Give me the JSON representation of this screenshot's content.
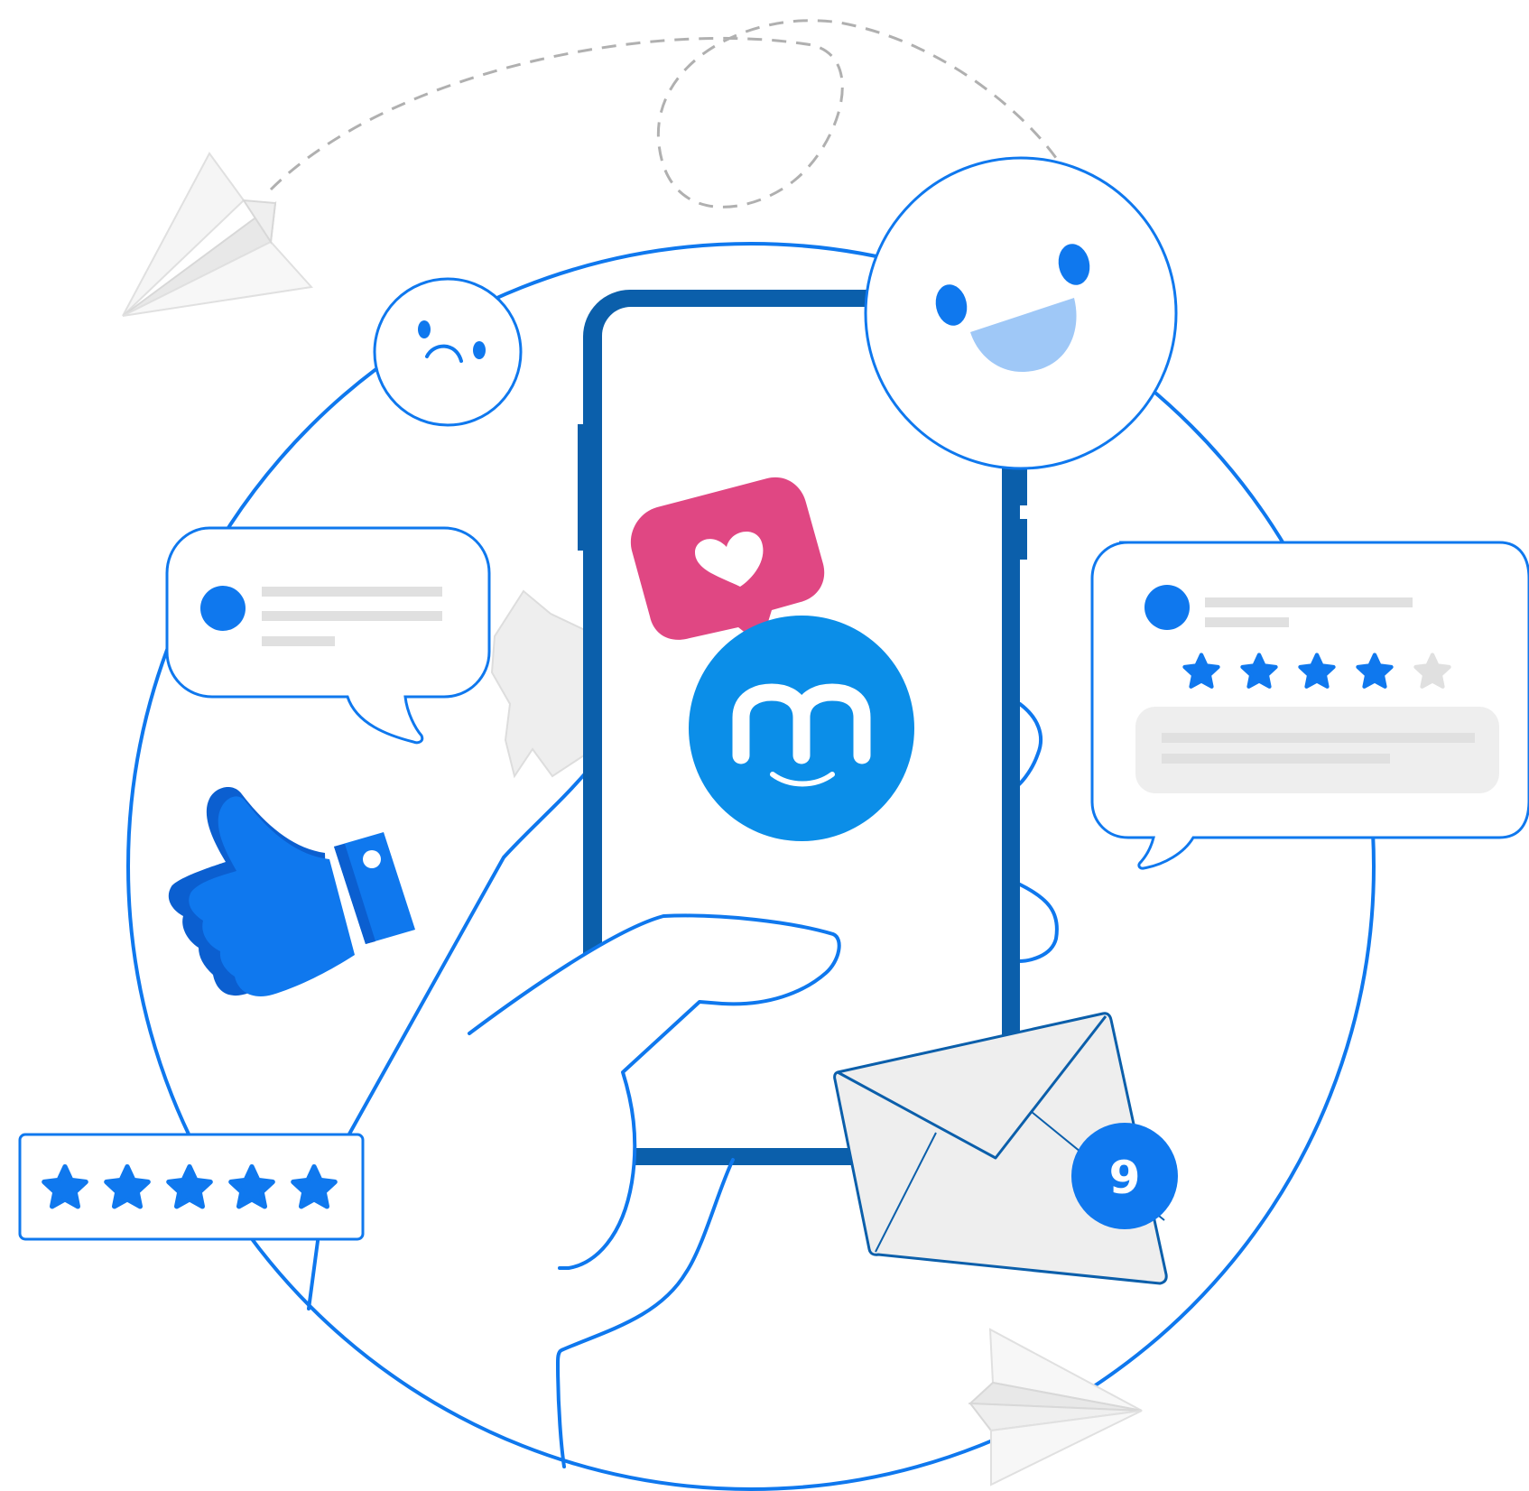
{
  "colors": {
    "primary_blue": "#0f78ee",
    "dark_blue": "#0b5fab",
    "app_blue": "#0b8ee8",
    "pink": "#e04783",
    "light_blue": "#9fc8f7",
    "gray_fill": "#eeeeee",
    "gray_line": "#e0e0e0",
    "dashed": "#b0b0b0"
  },
  "icons": {
    "app_logo": "myjobmatcher-m-smile-logo",
    "sad_face": "sad-face-icon",
    "happy_face": "happy-face-icon",
    "heart_notification": "heart-notification-icon",
    "thumbs_up": "thumbs-up-icon",
    "envelope": "envelope-icon",
    "paper_plane": "paper-plane-icon",
    "star": "star-icon"
  },
  "review_card": {
    "rating": 4,
    "max_rating": 5
  },
  "rating_box": {
    "rating": 5,
    "max_rating": 5
  },
  "notification_badge": {
    "count": "9"
  }
}
